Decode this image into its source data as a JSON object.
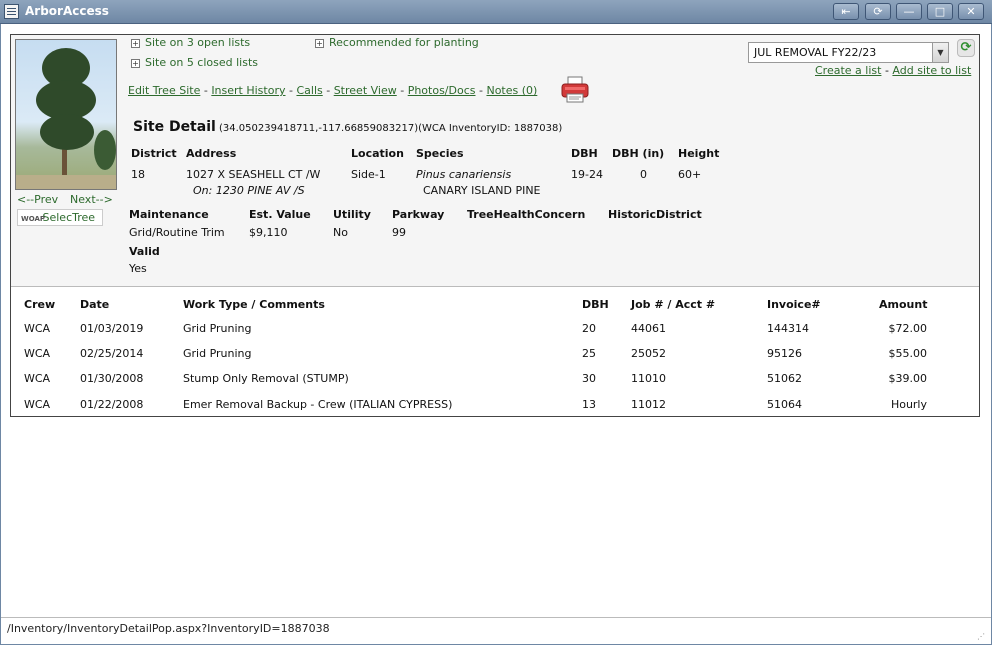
{
  "window": {
    "title": "ArborAccess",
    "buttons": [
      "⇤",
      "⟳",
      "—",
      "□",
      "✕"
    ]
  },
  "lists": {
    "open": "Site on 3 open lists",
    "closed": "Site on 5 closed lists",
    "recommended": "Recommended for planting"
  },
  "nav": {
    "prev": "<--Prev",
    "next": "Next-->",
    "selectree": "SelecTree",
    "selectree_logo": "WOAP"
  },
  "links": [
    "Edit Tree Site",
    "Insert History",
    "Calls",
    "Street View",
    "Photos/Docs",
    "Notes (0)"
  ],
  "list_select": {
    "value": "JUL REMOVAL FY22/23",
    "create": "Create a list",
    "add": "Add site to list"
  },
  "site": {
    "title": "Site Detail",
    "coords": "(34.050239418711,-117.66859083217)(WCA InventoryID: 1887038)"
  },
  "fields1": {
    "district_label": "District",
    "district": "18",
    "address_label": "Address",
    "address": "1027 X SEASHELL CT /W",
    "on": "On: 1230 PINE AV /S",
    "location_label": "Location",
    "location": "Side-1",
    "species_label": "Species",
    "species_latin": "Pinus canariensis",
    "species_common": "CANARY ISLAND PINE",
    "dbh_label": "DBH",
    "dbh": "19-24",
    "dbhin_label": "DBH (in)",
    "dbhin": "0",
    "height_label": "Height",
    "height": "60+"
  },
  "fields2": {
    "maint_label": "Maintenance",
    "maint": "Grid/Routine Trim",
    "value_label": "Est. Value",
    "value": "$9,110",
    "utility_label": "Utility",
    "utility": "No",
    "parkway_label": "Parkway",
    "parkway": "99",
    "health_label": "TreeHealthConcern",
    "historic_label": "HistoricDistrict",
    "valid_label": "Valid",
    "valid": "Yes"
  },
  "history": {
    "headers": [
      "Crew",
      "Date",
      "Work Type / Comments",
      "DBH",
      "Job # / Acct #",
      "Invoice#",
      "Amount"
    ],
    "rows": [
      [
        "WCA",
        "01/03/2019",
        "Grid Pruning",
        "20",
        "44061",
        "144314",
        "$72.00"
      ],
      [
        "WCA",
        "02/25/2014",
        "Grid Pruning",
        "25",
        "25052",
        "95126",
        "$55.00"
      ],
      [
        "WCA",
        "01/30/2008",
        "Stump Only Removal (STUMP)",
        "30",
        "11010",
        "51062",
        "$39.00"
      ],
      [
        "WCA",
        "01/22/2008",
        "Emer Removal Backup - Crew (ITALIAN CYPRESS)",
        "13",
        "11012",
        "51064",
        "Hourly"
      ]
    ]
  },
  "status": {
    "url": "/Inventory/InventoryDetailPop.aspx?InventoryID=1887038"
  },
  "colors": {
    "link": "#2d6a2d",
    "titlebar": "#7890ad"
  }
}
